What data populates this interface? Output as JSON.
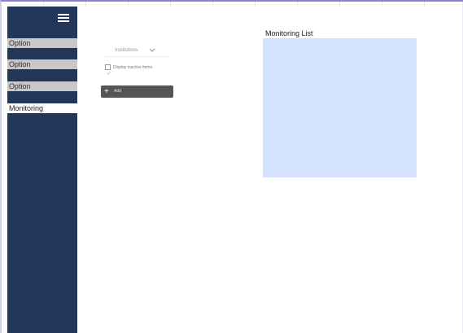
{
  "sidebar": {
    "menu_icon": "hamburger-menu-icon",
    "items": [
      {
        "label": "Option",
        "active": false
      },
      {
        "label": "Option",
        "active": false
      },
      {
        "label": "Option",
        "active": false
      },
      {
        "label": "Monitoring",
        "active": true
      }
    ]
  },
  "filters": {
    "select_value": "Institutions",
    "select_icon": "chevron-down-icon",
    "checkbox_label": "Display inactive items",
    "checkbox_checked": false
  },
  "actions": {
    "add_label": "Add",
    "add_icon": "plus-icon"
  },
  "list": {
    "title": "Monitoring List"
  },
  "colors": {
    "sidebar_bg": "#23375a",
    "option_bg": "#c8c8c8",
    "active_bg": "#ffffff",
    "button_bg": "#555555",
    "list_panel_bg": "#d4e3fd",
    "window_border": "#8c80d6"
  }
}
